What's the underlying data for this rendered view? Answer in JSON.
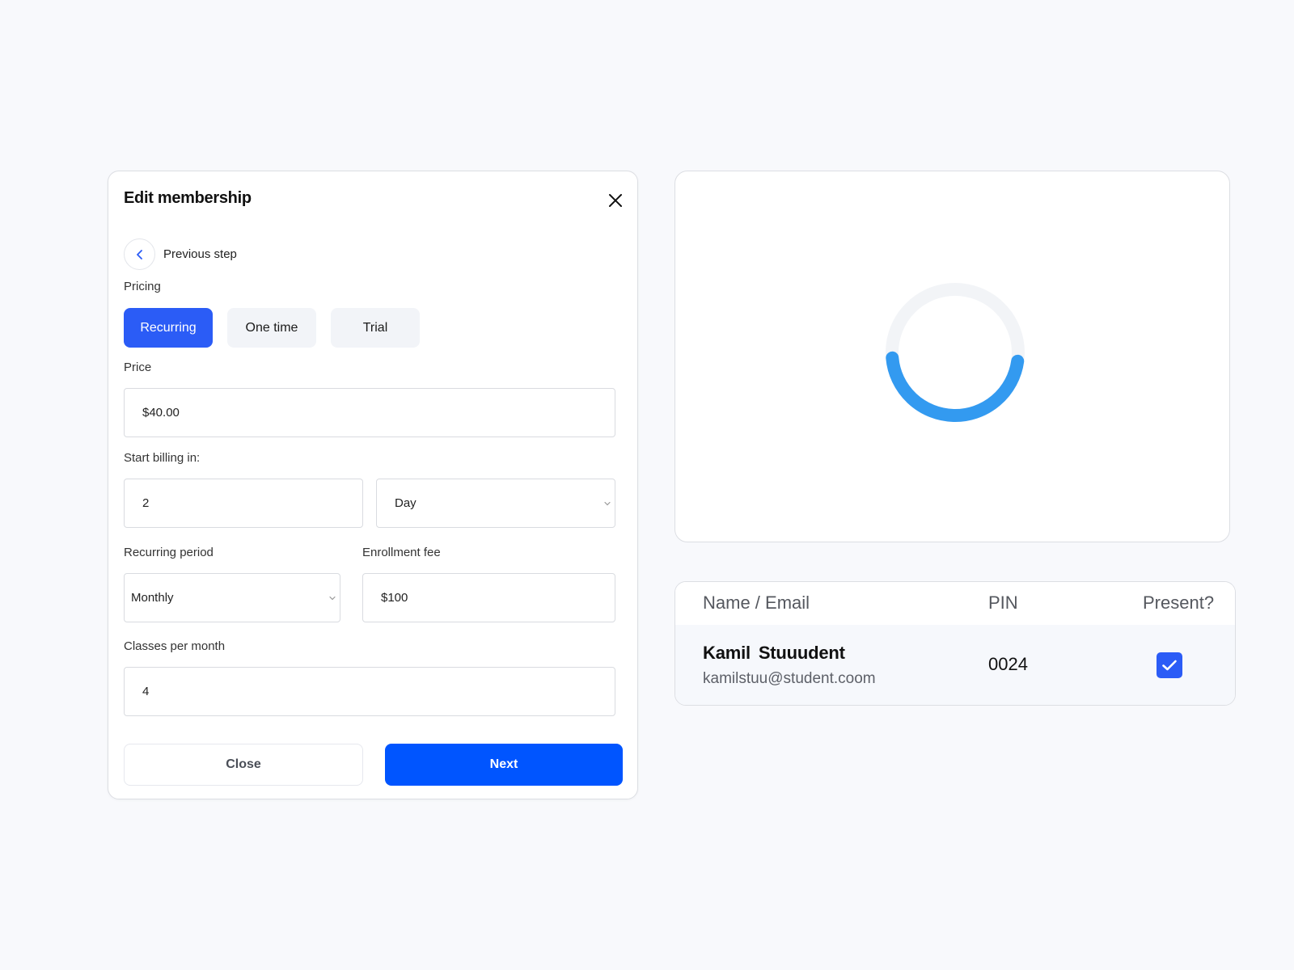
{
  "modal": {
    "title": "Edit membership",
    "close_icon": "close-icon",
    "previous_step_label": "Previous step",
    "pricing_label": "Pricing",
    "pricing_options": [
      {
        "label": "Recurring",
        "selected": true
      },
      {
        "label": "One time",
        "selected": false
      },
      {
        "label": "Trial",
        "selected": false
      }
    ],
    "price": {
      "label": "Price",
      "value": "$40.00"
    },
    "start_billing": {
      "label": "Start billing in:",
      "amount": "2",
      "unit": "Day"
    },
    "recurring_period": {
      "label": "Recurring period",
      "value": "Monthly"
    },
    "enrollment_fee": {
      "label": "Enrollment fee",
      "value": "$100"
    },
    "classes_per_month": {
      "label": "Classes per month",
      "value": "4"
    },
    "buttons": {
      "close": "Close",
      "next": "Next"
    }
  },
  "loader": {
    "icon": "loading-spinner",
    "colors": {
      "track": "#f2f4f7",
      "arc": "#339af0"
    }
  },
  "attendance": {
    "columns": [
      "Name / Email",
      "PIN",
      "Present?"
    ],
    "rows": [
      {
        "name": "Kamil  Stuuudent",
        "email": "kamilstuu@student.coom",
        "pin": "0024",
        "present": true
      }
    ]
  },
  "colors": {
    "primary": "#0055ff",
    "segment_active": "#2b5cf6",
    "checkbox": "#2b5cf6",
    "background": "#f8f9fc"
  }
}
